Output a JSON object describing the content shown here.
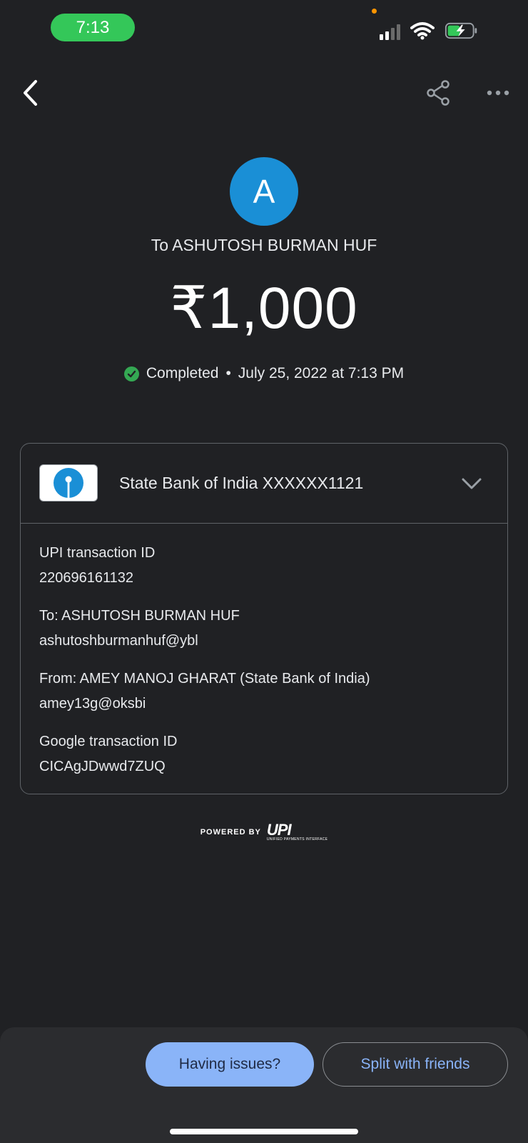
{
  "status_bar": {
    "time": "7:13",
    "icons": [
      "signal-icon",
      "wifi-icon",
      "battery-charging-icon"
    ]
  },
  "top_bar": {
    "icons": [
      "back-arrow-icon",
      "share-icon",
      "more-horiz-icon"
    ]
  },
  "payee": {
    "avatar_letter": "A",
    "avatar_color": "#1a8fd6",
    "name_line": "To ASHUTOSH BURMAN HUF"
  },
  "amount": "₹1,000",
  "status": {
    "text": "Completed",
    "separator": "•",
    "datetime": "July 25, 2022 at 7:13 PM",
    "color": "#34a853"
  },
  "bank": {
    "name": "State Bank of India XXXXXX1121",
    "logo_icon": "sbi-logo-icon",
    "expand_icon": "chevron-down-icon"
  },
  "details": [
    {
      "label": "UPI transaction ID",
      "value": "220696161132"
    },
    {
      "label": "To: ASHUTOSH BURMAN HUF",
      "value": "ashutoshburmanhuf@ybl"
    },
    {
      "label": "From: AMEY MANOJ GHARAT (State Bank of India)",
      "value": "amey13g@oksbi"
    },
    {
      "label": "Google transaction ID",
      "value": "CICAgJDwwd7ZUQ"
    }
  ],
  "powered_by": {
    "text": "POWERED BY",
    "logo": "UPI",
    "logo_subtext": "UNIFIED PAYMENTS INTERFACE"
  },
  "actions": {
    "issues_label": "Having issues?",
    "split_label": "Split with friends"
  },
  "colors": {
    "background": "#202124",
    "accent": "#8ab4f8"
  }
}
